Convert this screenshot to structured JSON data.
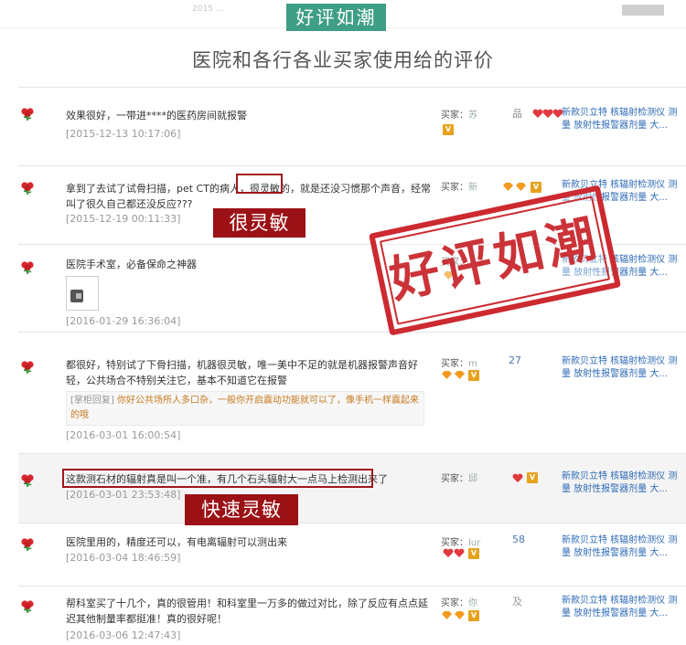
{
  "banner": {
    "title": "好评如潮"
  },
  "subtitle": "医院和各行各业买家使用给的评价",
  "top_strip": {
    "faint_left": "2015 …",
    "faint_mid": "",
    "faint_right": ""
  },
  "reviews": [
    {
      "content": "效果很好，一带进****的医药房间就报警",
      "date": "[2015-12-13 10:17:06]",
      "buyer_label": "买家：",
      "buyer_name": "苏",
      "buyer_extra": "品",
      "product": "新款贝立特 核辐射检测仪 测量 放射性报警器剂量 大..."
    },
    {
      "content_before": "拿到了去试了试骨扫描，pet CT的病人，",
      "content_highlight": "很灵敏的",
      "content_after": "，就是还没习惯那个声音，经常叫了很久自己都还没反应???",
      "date": "[2015-12-19 00:11:33]",
      "buyer_label": "买家：",
      "buyer_name": "新",
      "product": "新款贝立特 核辐射检测仪 测量 放射性报警器剂量 大..."
    },
    {
      "content": "医院手术室，必备保命之神器",
      "date": "[2016-01-29 16:36:04]",
      "buyer_label": "买家：",
      "buyer_name": "",
      "product": "新款贝立特 核辐射检测仪 测量 放射性报警器剂量 大..."
    },
    {
      "content": "都很好，特别试了下骨扫描，机器很灵敏，唯一美中不足的就是机器报警声音好轻，公共场合不特别关注它，基本不知道它在报警",
      "reply_tag": "[掌柜回复]",
      "reply": "你好公共场所人多口杂，一般你开启震动功能就可以了，像手机一样震起来的哦",
      "date": "[2016-03-01 16:00:54]",
      "buyer_label": "买家：",
      "buyer_name": "m",
      "buyer_num": "27",
      "product": "新款贝立特 核辐射检测仪 测量 放射性报警器剂量 大..."
    },
    {
      "content": "这款测石材的辐射真是叫一个准，有几个石头辐射大一点马上检测出来了",
      "date": "[2016-03-01 23:53:48]",
      "buyer_label": "买家：",
      "buyer_name": "邱",
      "product": "新款贝立特 核辐射检测仪 测量 放射性报警器剂量 大..."
    },
    {
      "content": "医院里用的，精度还可以，有电离辐射可以测出来",
      "date": "[2016-03-04 18:46:59]",
      "buyer_label": "买家：",
      "buyer_name": "lur",
      "buyer_num": "58",
      "product": "新款贝立特 核辐射检测仪 测量 放射性报警器剂量 大..."
    },
    {
      "content": "帮科室买了十几个，真的很管用！和科室里一万多的做过对比，除了反应有点点延迟其他制量率都挺准！真的很好呢！",
      "date": "[2016-03-06 12:47:43]",
      "buyer_label": "买家：",
      "buyer_name": "你",
      "buyer_num": "及",
      "product": "新款贝立特 核辐射检测仪 测量 放射性报警器剂量 大..."
    }
  ],
  "annotations": {
    "label_1": "很灵敏",
    "label_2": "快速灵敏"
  },
  "stamp": {
    "text": "好评如潮"
  },
  "colors": {
    "banner_bg": "#3f9e86",
    "annotation_red": "#9b1116",
    "stamp_red": "#c8242a",
    "link_blue": "#2d6ab5"
  }
}
